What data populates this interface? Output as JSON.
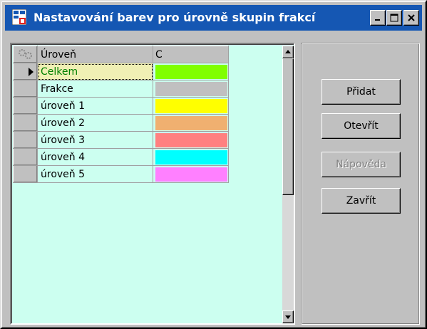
{
  "window": {
    "title": "Nastavování barev pro úrovně skupin frakcí",
    "app_icon": "ep-app-icon",
    "controls": {
      "minimize_icon": "minimize-icon",
      "maximize_icon": "maximize-icon",
      "close_icon": "close-icon"
    }
  },
  "grid": {
    "headers": {
      "name": "Úroveň",
      "color": "C"
    },
    "header_icon": "gears-icon",
    "current_row_icon": "row-pointer-icon",
    "rows": [
      {
        "name": "Celkem",
        "color": "#80ff00",
        "active": true
      },
      {
        "name": "Frakce",
        "color": "#c0c0c0"
      },
      {
        "name": "úroveň 1",
        "color": "#ffff00"
      },
      {
        "name": "úroveň 2",
        "color": "#f0b070"
      },
      {
        "name": "úroveň 3",
        "color": "#ff8080"
      },
      {
        "name": "úroveň 4",
        "color": "#00ffff"
      },
      {
        "name": "úroveň 5",
        "color": "#ff80ff"
      }
    ]
  },
  "buttons": {
    "add": "Přidat",
    "open": "Otevřít",
    "help": "Nápověda",
    "close": "Zavřít"
  },
  "colors": {
    "titlebar": "#1557b3",
    "grid_background": "#ccfff0",
    "active_row_text": "#008000"
  }
}
